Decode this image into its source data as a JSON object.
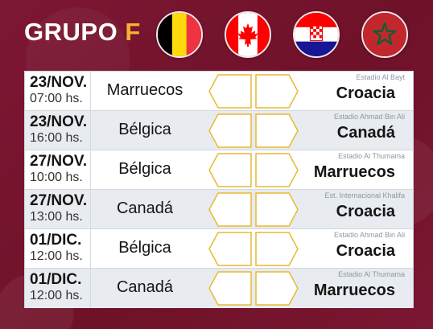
{
  "header": {
    "title_main": "GRUPO",
    "title_accent": "F",
    "flags": [
      {
        "name": "belgium-flag-icon",
        "colors": [
          "#000000",
          "#FFD90C",
          "#EF3340"
        ]
      },
      {
        "name": "canada-flag-icon",
        "colors": [
          "#FF0000",
          "#FFFFFF",
          "#FF0000"
        ]
      },
      {
        "name": "croatia-flag-icon",
        "colors": [
          "#FF0000",
          "#FFFFFF",
          "#171796"
        ]
      },
      {
        "name": "morocco-flag-icon",
        "colors": [
          "#C1272D",
          "#006233"
        ]
      }
    ]
  },
  "theme": {
    "background": "#7A1630",
    "accent": "#F2B233",
    "row_alt": "#E8EBEF",
    "score_box_stroke": "#E7B933"
  },
  "matches": [
    {
      "date": "23/NOV.",
      "time": "07:00 hs.",
      "home": "Marruecos",
      "venue": "Estadio Al Bayt",
      "away": "Croacia"
    },
    {
      "date": "23/NOV.",
      "time": "16:00 hs.",
      "home": "Bélgica",
      "venue": "Estadio Ahmad Bin Ali",
      "away": "Canadá"
    },
    {
      "date": "27/NOV.",
      "time": "10:00 hs.",
      "home": "Bélgica",
      "venue": "Estadio Al Thumama",
      "away": "Marruecos"
    },
    {
      "date": "27/NOV.",
      "time": "13:00 hs.",
      "home": "Canadá",
      "venue": "Est. Internacional Khalifa",
      "away": "Croacia"
    },
    {
      "date": "01/DIC.",
      "time": "12:00 hs.",
      "home": "Bélgica",
      "venue": "Estadio Ahmad Bin Ali",
      "away": "Croacia"
    },
    {
      "date": "01/DIC.",
      "time": "12:00 hs.",
      "home": "Canadá",
      "venue": "Estadio Al Thumama",
      "away": "Marruecos"
    }
  ]
}
